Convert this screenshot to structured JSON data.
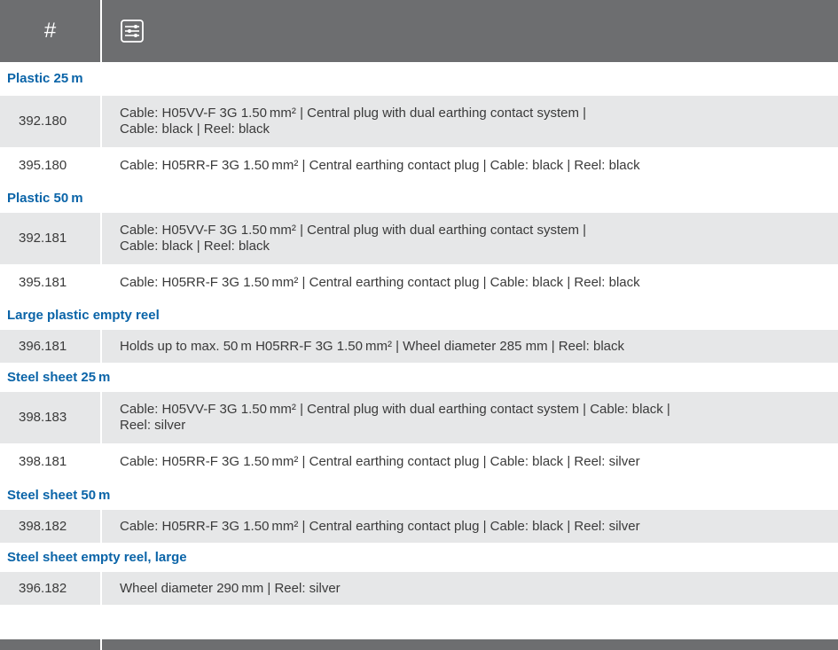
{
  "header": {
    "hash_label": "#",
    "filter_icon": "sliders-icon"
  },
  "colors": {
    "header_bg": "#6d6e70",
    "group_title": "#0a64a8",
    "row_shade": "#e6e7e8"
  },
  "groups": [
    {
      "title": "Plastic 25 m",
      "rows": [
        {
          "num": "392.180",
          "desc_line1": "Cable: H05VV-F 3G 1.50 mm² | Central plug with dual earthing contact system |",
          "desc_line2": "Cable: black | Reel: black"
        },
        {
          "num": "395.180",
          "desc_line1": "Cable: H05RR-F 3G 1.50 mm² | Central earthing contact plug | Cable: black | Reel: black",
          "desc_line2": ""
        }
      ]
    },
    {
      "title": "Plastic 50 m",
      "rows": [
        {
          "num": "392.181",
          "desc_line1": "Cable: H05VV-F 3G 1.50 mm² | Central plug with dual earthing contact system |",
          "desc_line2": "Cable: black | Reel: black"
        },
        {
          "num": "395.181",
          "desc_line1": "Cable: H05RR-F 3G 1.50 mm² | Central earthing contact plug | Cable: black | Reel: black",
          "desc_line2": ""
        }
      ]
    },
    {
      "title": "Large plastic empty reel",
      "rows": [
        {
          "num": "396.181",
          "desc_line1": "Holds up to max. 50 m H05RR-F 3G 1.50 mm² | Wheel diameter 285 mm | Reel: black",
          "desc_line2": ""
        }
      ]
    },
    {
      "title": "Steel sheet 25 m",
      "rows": [
        {
          "num": "398.183",
          "desc_line1": "Cable: H05VV-F 3G 1.50 mm² | Central plug with dual earthing contact system | Cable: black |",
          "desc_line2": "Reel: silver"
        },
        {
          "num": "398.181",
          "desc_line1": "Cable: H05RR-F 3G 1.50 mm² | Central earthing contact plug | Cable: black | Reel: silver",
          "desc_line2": ""
        }
      ]
    },
    {
      "title": "Steel sheet 50 m",
      "rows": [
        {
          "num": "398.182",
          "desc_line1": "Cable: H05RR-F 3G 1.50 mm² | Central earthing contact plug | Cable: black | Reel: silver",
          "desc_line2": ""
        }
      ]
    },
    {
      "title": "Steel sheet empty reel, large",
      "rows": [
        {
          "num": "396.182",
          "desc_line1": "Wheel diameter 290 mm | Reel: silver",
          "desc_line2": ""
        }
      ]
    }
  ]
}
